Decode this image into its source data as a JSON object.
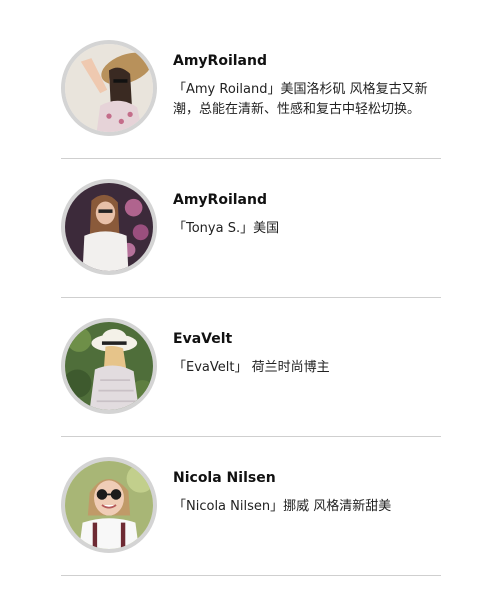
{
  "people": [
    {
      "name": "AmyRoiland",
      "description": "「Amy Roiland」美国洛杉矶 风格复古又新潮，总能在清新、性感和复古中轻松切换。"
    },
    {
      "name": "AmyRoiland",
      "description": "「Tonya S.」美国"
    },
    {
      "name": "EvaVelt",
      "description": "「EvaVelt」 荷兰时尚博主"
    },
    {
      "name": "Nicola Nilsen",
      "description": "「Nicola Nilsen」挪威 风格清新甜美"
    }
  ]
}
